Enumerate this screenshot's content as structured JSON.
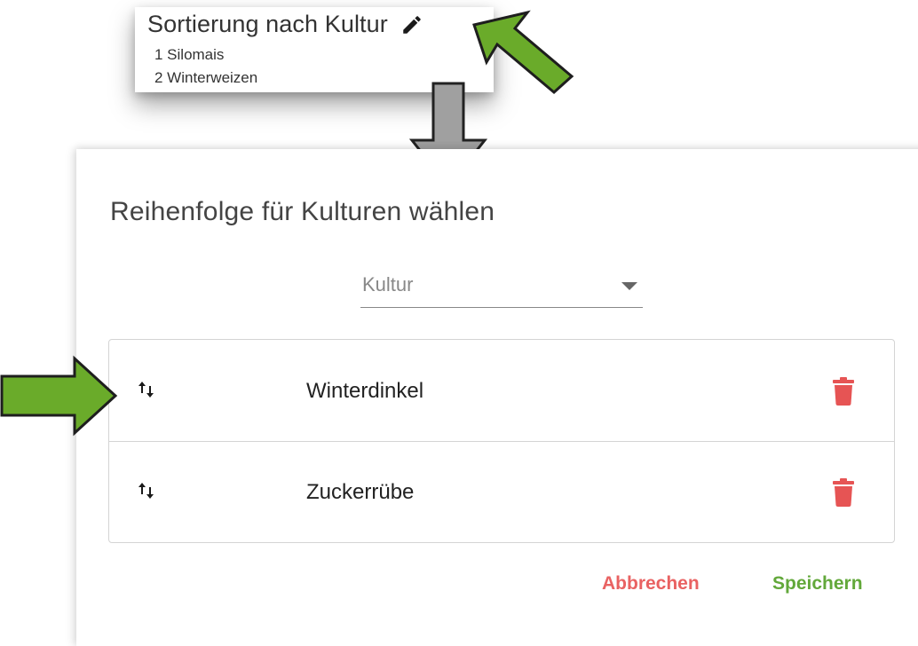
{
  "sort_card": {
    "title": "Sortierung nach Kultur",
    "items": [
      {
        "label": "1 Silomais"
      },
      {
        "label": "2 Winterweizen"
      }
    ]
  },
  "dialog": {
    "title": "Reihenfolge für Kulturen wählen",
    "select": {
      "value": "Kultur"
    },
    "rows": [
      {
        "label": "Winterdinkel"
      },
      {
        "label": "Zuckerrübe"
      }
    ],
    "cancel_label": "Abbrechen",
    "save_label": "Speichern"
  },
  "colors": {
    "accent_green": "#62a83a",
    "danger_red": "#e96262",
    "arrow_green": "#6aab2a",
    "arrow_gray": "#a0a0a0"
  },
  "icons": [
    "edit-pencil-icon",
    "dropdown-caret-icon",
    "reorder-arrows-icon",
    "trash-icon",
    "annotation-arrow"
  ]
}
